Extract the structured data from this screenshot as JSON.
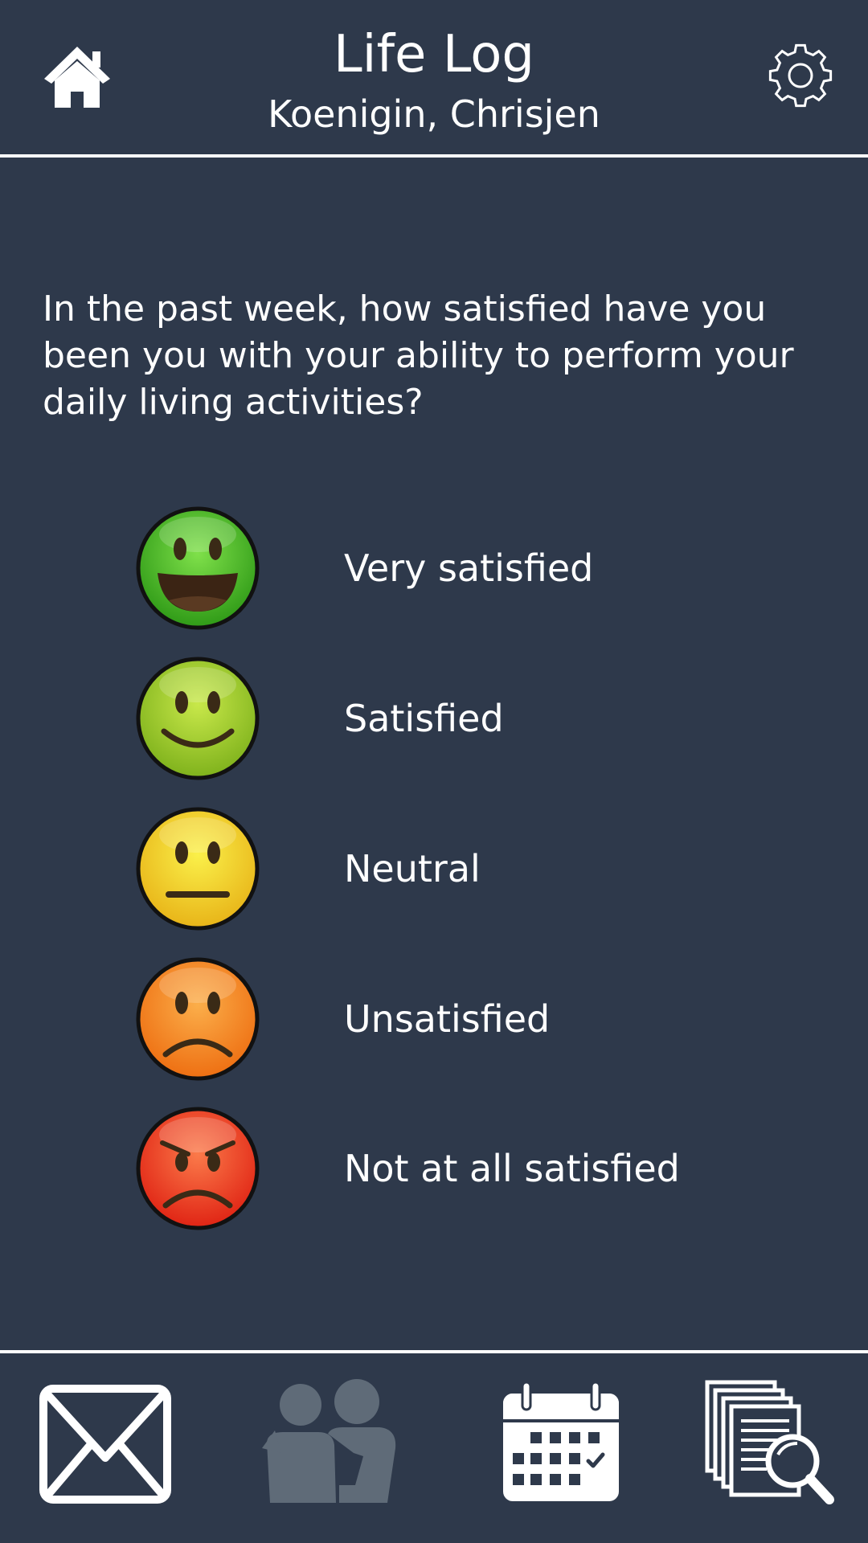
{
  "header": {
    "title": "Life Log",
    "subtitle": "Koenigin, Chrisjen",
    "home_icon": "home-icon",
    "settings_icon": "gear-icon"
  },
  "question": {
    "text": "In the past week, how satisfied have you been you with your ability to perform your daily living activities?"
  },
  "options": [
    {
      "label": "Very satisfied",
      "icon": "very-happy-face-icon",
      "color": "#4cb82a"
    },
    {
      "label": "Satisfied",
      "icon": "happy-face-icon",
      "color": "#9dcb26"
    },
    {
      "label": "Neutral",
      "icon": "neutral-face-icon",
      "color": "#f2dc1e"
    },
    {
      "label": "Unsatisfied",
      "icon": "sad-face-icon",
      "color": "#f5861f"
    },
    {
      "label": "Not at all satisfied",
      "icon": "angry-face-icon",
      "color": "#e8381f"
    }
  ],
  "nav": [
    {
      "icon": "mail-icon"
    },
    {
      "icon": "people-icon"
    },
    {
      "icon": "calendar-icon"
    },
    {
      "icon": "document-search-icon"
    }
  ],
  "colors": {
    "background": "#2e394b",
    "foreground": "#ffffff",
    "disabled_icon": "#5f6b78"
  }
}
